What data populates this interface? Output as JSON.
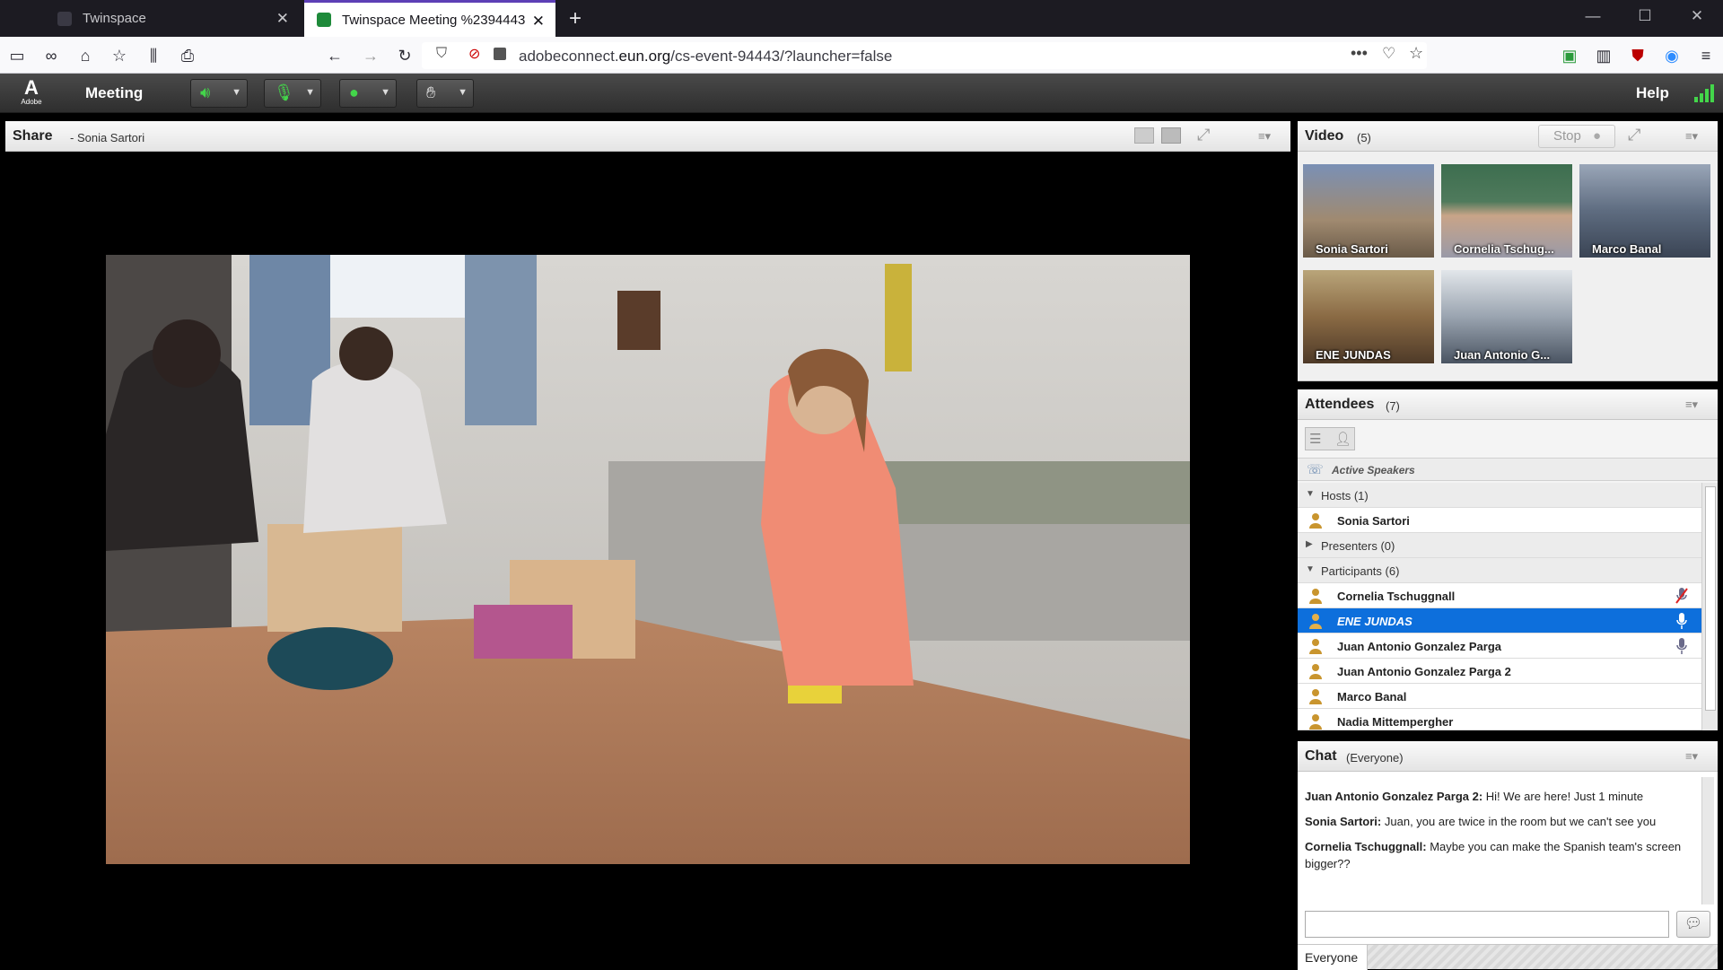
{
  "browser": {
    "tabs": [
      {
        "title": "Twinspace",
        "active": false
      },
      {
        "title": "Twinspace Meeting %2394443",
        "active": true
      }
    ],
    "url": {
      "host_prefix": "adobeconnect.",
      "domain": "eun.org",
      "path": "/cs-event-94443/?launcher=false"
    }
  },
  "app": {
    "logo_text": "Adobe",
    "meeting_menu": "Meeting",
    "help": "Help",
    "accent_green": "#43d64a"
  },
  "share_pod": {
    "title": "Share",
    "subtitle": "- Sonia Sartori"
  },
  "video_pod": {
    "title": "Video",
    "count": "(5)",
    "stop_label": "Stop",
    "tiles": [
      {
        "name": "Sonia Sartori"
      },
      {
        "name": "Cornelia Tschug..."
      },
      {
        "name": "Marco Banal"
      },
      {
        "name": "ENE JUNDAS"
      },
      {
        "name": "Juan Antonio G..."
      }
    ]
  },
  "attendees_pod": {
    "title": "Attendees",
    "count": "(7)",
    "active_speakers": "Active Speakers",
    "hosts_label": "Hosts (1)",
    "hosts": [
      "Sonia Sartori"
    ],
    "presenters_label": "Presenters (0)",
    "participants_label": "Participants (6)",
    "participants": [
      {
        "name": "Cornelia Tschuggnall",
        "mic": "muted",
        "selected": false
      },
      {
        "name": "ENE JUNDAS",
        "mic": "on",
        "selected": true
      },
      {
        "name": "Juan Antonio Gonzalez Parga",
        "mic": "on",
        "selected": false
      },
      {
        "name": "Juan Antonio Gonzalez Parga 2",
        "mic": "",
        "selected": false
      },
      {
        "name": "Marco Banal",
        "mic": "",
        "selected": false
      },
      {
        "name": "Nadia Mittempergher",
        "mic": "",
        "selected": false
      }
    ],
    "selection_color": "#0d6fdc"
  },
  "chat_pod": {
    "title": "Chat",
    "scope": "(Everyone)",
    "messages": [
      {
        "sender": "Juan Antonio Gonzalez Parga 2:",
        "text": "Hi! We are here! Just 1 minute"
      },
      {
        "sender": "Sonia Sartori:",
        "text": "Juan, you are twice in the room but we can't see you"
      },
      {
        "sender": "Cornelia Tschuggnall:",
        "text": "Maybe you can make the Spanish team's screen bigger??"
      }
    ],
    "input_value": "",
    "footer_label": "Everyone"
  }
}
